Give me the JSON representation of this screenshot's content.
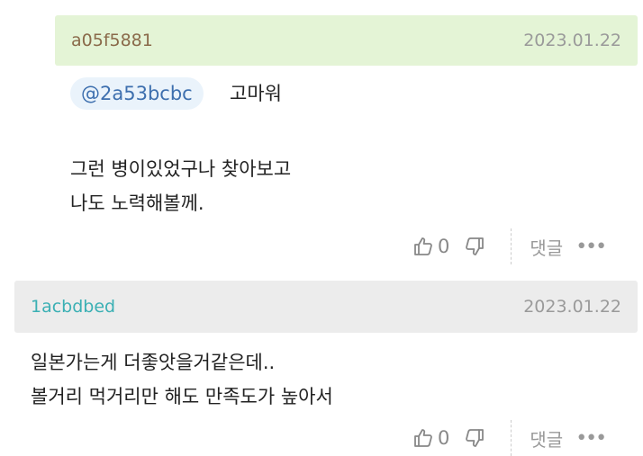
{
  "reply": {
    "author": "a05f5881",
    "date": "2023.01.22",
    "mention": "@2a53bcbc",
    "mention_text": "고마워",
    "lines": [
      "그런 병이있었구나 찾아보고",
      "나도 노력해볼께."
    ],
    "like_count": "0",
    "reply_label": "댓글",
    "more_label": "•••"
  },
  "comment": {
    "author": "1acbdbed",
    "date": "2023.01.22",
    "lines": [
      "일본가는게 더좋앗을거같은데..",
      "볼거리 먹거리만 해도 만족도가 높아서"
    ],
    "like_count": "0",
    "reply_label": "댓글",
    "more_label": "•••"
  },
  "icons": [
    "thumbs-up-icon",
    "thumbs-down-icon",
    "more-icon"
  ]
}
